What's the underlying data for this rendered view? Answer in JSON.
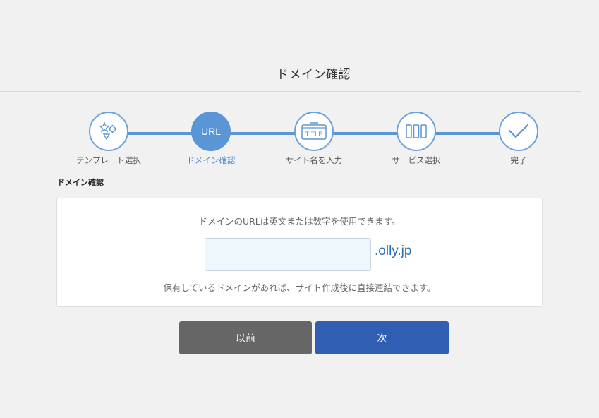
{
  "header": {
    "title": "ドメイン確認"
  },
  "stepper": {
    "steps": [
      {
        "label": "テンプレート選択",
        "icon": "template-icon",
        "state": "done"
      },
      {
        "label": "ドメイン確認",
        "icon_text": "URL",
        "state": "active"
      },
      {
        "label": "サイト名を入力",
        "icon": "title-icon",
        "icon_text": "TITLE",
        "state": "upcoming"
      },
      {
        "label": "サービス選択",
        "icon": "columns-icon",
        "state": "upcoming"
      },
      {
        "label": "完了",
        "icon": "checkmark-icon",
        "state": "upcoming"
      }
    ]
  },
  "section": {
    "heading": "ドメイン確認"
  },
  "domain_form": {
    "instruction": "ドメインのURLは英文または数字を使用できます。",
    "input_value": "",
    "suffix": ".olly.jp",
    "note": "保有しているドメインがあれば、サイト作成後に直接連結できます。"
  },
  "buttons": {
    "prev_label": "以前",
    "next_label": "次"
  },
  "colors": {
    "accent": "#5a96d6",
    "primary_button": "#2f5eb3",
    "secondary_button": "#666666",
    "background": "#f1f1f1"
  }
}
